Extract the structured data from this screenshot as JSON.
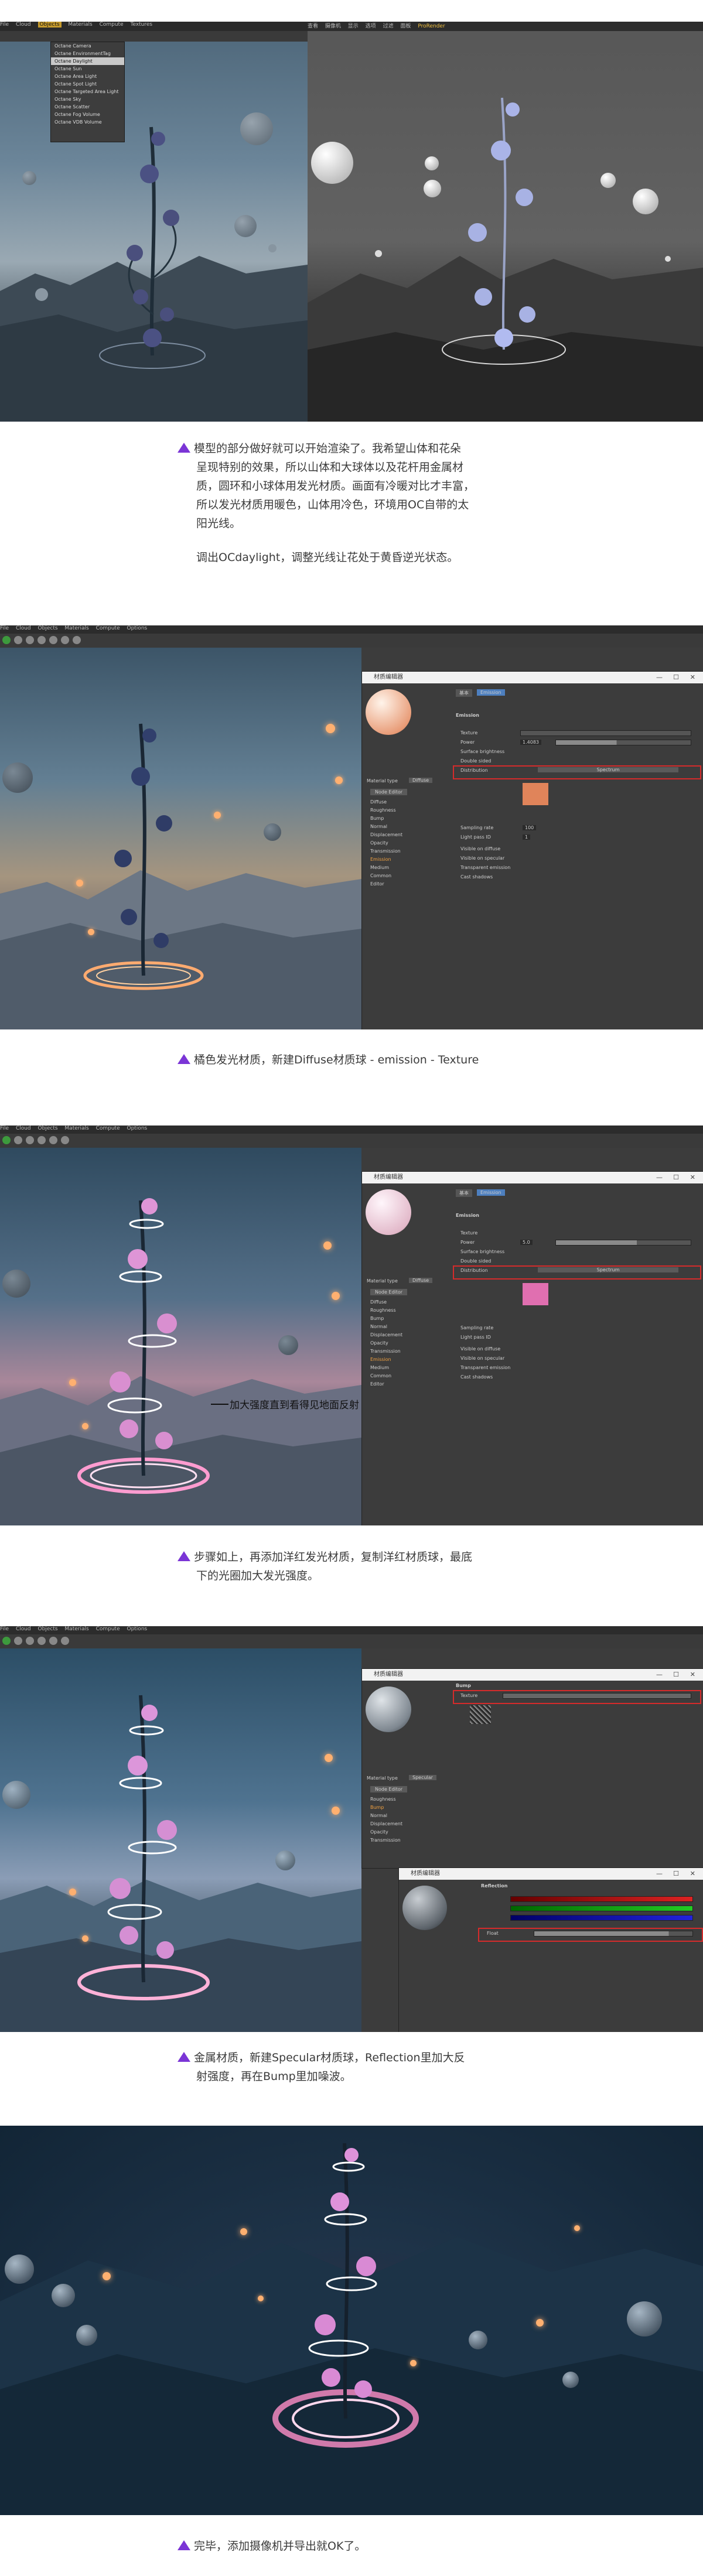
{
  "colors": {
    "accent": "#7b35d6",
    "highlight": "#d52b2b",
    "c4d_bg": "#3c3c3c"
  },
  "screens": {
    "s1": {
      "left_menu": [
        "File",
        "Cloud",
        "Objects",
        "Materials",
        "Compute",
        "Textures"
      ],
      "dropdown": [
        "Octane Camera",
        "Octane EnvironmentTag",
        "Octane Daylight",
        "Octane Sun",
        "Octane Area Light",
        "Octane Spot Light",
        "Octane Targeted Area Light",
        "Octane Sky",
        "Octane Scatter",
        "Octane Fog Volume",
        "Octane VDB Volume"
      ],
      "right_menu": [
        "查看",
        "摄像机",
        "显示",
        "选项",
        "过滤",
        "面板",
        "ProRender"
      ]
    },
    "s2": {
      "menu": [
        "File",
        "Cloud",
        "Objects",
        "Materials",
        "Compute",
        "Options"
      ],
      "panel_title": "材质编辑器",
      "tabs": [
        "基本",
        "Emission"
      ],
      "section": "Emission",
      "rows": [
        "Texture",
        "Power",
        "Surface brightness",
        "Double sided",
        "Distribution",
        "Sampling rate",
        "Light pass ID",
        "Visible on diffuse",
        "Visible on specular",
        "Transparent emission",
        "Cast shadows"
      ],
      "power_value": "1.4083",
      "distribution_label": "Spectrum",
      "material_list": [
        "Material type",
        "Node Editor",
        "Diffuse",
        "Roughness",
        "Bump",
        "Normal",
        "Displacement",
        "Opacity",
        "Transmission",
        "Emission",
        "Medium",
        "Common",
        "Editor"
      ],
      "material_type": "Diffuse",
      "sampling_value": "100",
      "light_pass_value": "1"
    },
    "s3": {
      "menu": [
        "File",
        "Cloud",
        "Objects",
        "Materials",
        "Compute",
        "Options"
      ],
      "panel_title": "材质编辑器",
      "tabs": [
        "基本",
        "Emission"
      ],
      "section": "Emission",
      "power_value": "5.0",
      "material_type": "Diffuse",
      "overlay_text": "加大强度直到看得见地面反射"
    },
    "s4": {
      "menu": [
        "File",
        "Cloud",
        "Objects",
        "Materials",
        "Compute",
        "Options"
      ],
      "panel_title": "材质编辑器",
      "section": "Bump",
      "texture_row": "Texture",
      "panel2_title": "材质编辑器",
      "section2": "Reflection",
      "material_type": "Specular",
      "float_label": "Float"
    }
  },
  "captions": {
    "c1": [
      "模型的部分做好就可以开始渲染了。我希望山体和花朵",
      "呈现特别的效果，所以山体和大球体以及花杆用金属材",
      "质，圆环和小球体用发光材质。画面有冷暖对比才丰富，",
      "所以发光材质用暖色，山体用冷色，环境用OC自带的太",
      "阳光线。"
    ],
    "c1b": "调出OCdaylight，调整光线让花处于黄昏逆光状态。",
    "c2": "橘色发光材质，新建Diffuse材质球 - emission - Texture",
    "c3": [
      "步骤如上，再添加洋红发光材质，复制洋红材质球，最底",
      "下的光圈加大发光强度。"
    ],
    "c4": [
      "金属材质，新建Specular材质球，Reflection里加大反",
      "射强度，再在Bump里加噪波。"
    ],
    "c5": "完毕，添加摄像机并导出就OK了。"
  }
}
